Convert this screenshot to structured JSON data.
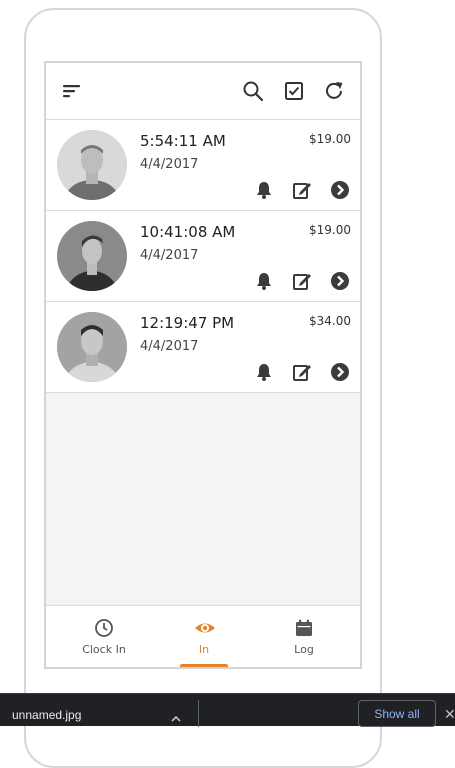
{
  "toolbar": {
    "icons": [
      "menu-icon",
      "search-icon",
      "checkbox-icon",
      "refresh-icon"
    ]
  },
  "entries": [
    {
      "time": "5:54:11 AM",
      "date": "4/4/2017",
      "amount": "$19.00"
    },
    {
      "time": "10:41:08 AM",
      "date": "4/4/2017",
      "amount": "$19.00"
    },
    {
      "time": "12:19:47 PM",
      "date": "4/4/2017",
      "amount": "$34.00"
    }
  ],
  "nav": {
    "clock_in": "Clock In",
    "in": "In",
    "log": "Log",
    "active": "in"
  },
  "colors": {
    "accent": "#e8822b",
    "icon": "#3b3b3b"
  },
  "download_bar": {
    "file_name": "unnamed.jpg",
    "show_all": "Show all",
    "close": "✕"
  }
}
